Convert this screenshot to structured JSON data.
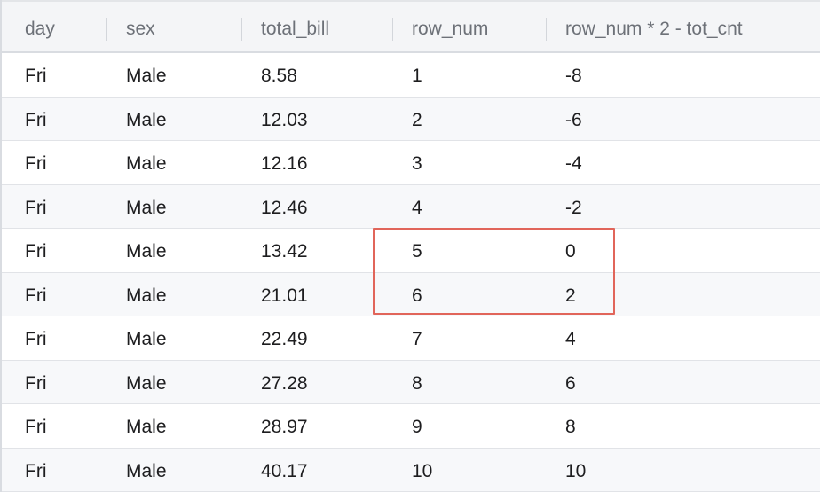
{
  "table": {
    "columns": [
      "day",
      "sex",
      "total_bill",
      "row_num",
      "row_num * 2 - tot_cnt"
    ],
    "rows": [
      [
        "Fri",
        "Male",
        "8.58",
        "1",
        "-8"
      ],
      [
        "Fri",
        "Male",
        "12.03",
        "2",
        "-6"
      ],
      [
        "Fri",
        "Male",
        "12.16",
        "3",
        "-4"
      ],
      [
        "Fri",
        "Male",
        "12.46",
        "4",
        "-2"
      ],
      [
        "Fri",
        "Male",
        "13.42",
        "5",
        "0"
      ],
      [
        "Fri",
        "Male",
        "21.01",
        "6",
        "2"
      ],
      [
        "Fri",
        "Male",
        "22.49",
        "7",
        "4"
      ],
      [
        "Fri",
        "Male",
        "27.28",
        "8",
        "6"
      ],
      [
        "Fri",
        "Male",
        "28.97",
        "9",
        "8"
      ],
      [
        "Fri",
        "Male",
        "40.17",
        "10",
        "10"
      ]
    ],
    "highlighted_rows": [
      4,
      5
    ],
    "highlighted_columns": [
      "row_num",
      "row_num * 2 - tot_cnt"
    ]
  },
  "colors": {
    "highlight_border": "#e1655a",
    "header_background": "#f4f5f7",
    "alt_row_background": "#f7f8fa"
  }
}
